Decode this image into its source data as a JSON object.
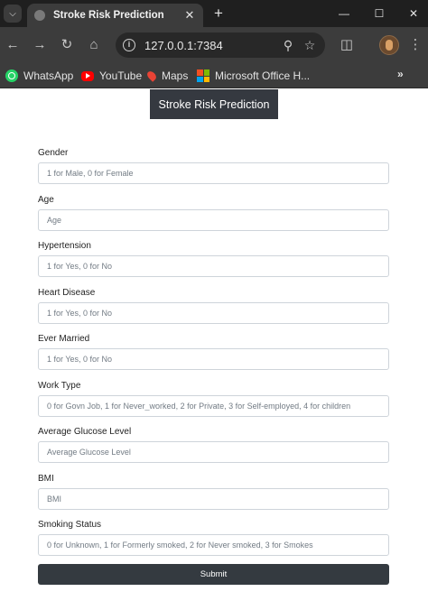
{
  "browser": {
    "tab": {
      "title": "Stroke Risk Prediction"
    },
    "url": "127.0.0.1:7384",
    "bookmarks": [
      {
        "label": "WhatsApp",
        "icon": "whatsapp-icon"
      },
      {
        "label": "YouTube",
        "icon": "youtube-icon"
      },
      {
        "label": "Maps",
        "icon": "maps-icon"
      },
      {
        "label": "Microsoft Office H...",
        "icon": "microsoft-office-icon"
      }
    ]
  },
  "page": {
    "heading": "Stroke Risk Prediction",
    "fields": [
      {
        "label": "Gender",
        "placeholder": "1 for Male, 0 for Female"
      },
      {
        "label": "Age",
        "placeholder": "Age"
      },
      {
        "label": "Hypertension",
        "placeholder": "1 for Yes, 0 for No"
      },
      {
        "label": "Heart Disease",
        "placeholder": "1 for Yes, 0 for No"
      },
      {
        "label": "Ever Married",
        "placeholder": "1 for Yes, 0 for No"
      },
      {
        "label": "Work Type",
        "placeholder": "0 for Govn Job, 1 for Never_worked, 2 for Private, 3 for Self-employed, 4 for children"
      },
      {
        "label": "Average Glucose Level",
        "placeholder": "Average Glucose Level"
      },
      {
        "label": "BMI",
        "placeholder": "BMI"
      },
      {
        "label": "Smoking Status",
        "placeholder": "0 for Unknown, 1 for Formerly smoked, 2 for Never smoked, 3 for Smokes"
      }
    ],
    "submit_label": "Submit"
  },
  "colors": {
    "chrome_dark": "#1f1f1f",
    "chrome_toolbar": "#3c3c3c",
    "heading_bg": "#353940",
    "submit_bg": "#343a40",
    "input_border": "#ced4da"
  }
}
